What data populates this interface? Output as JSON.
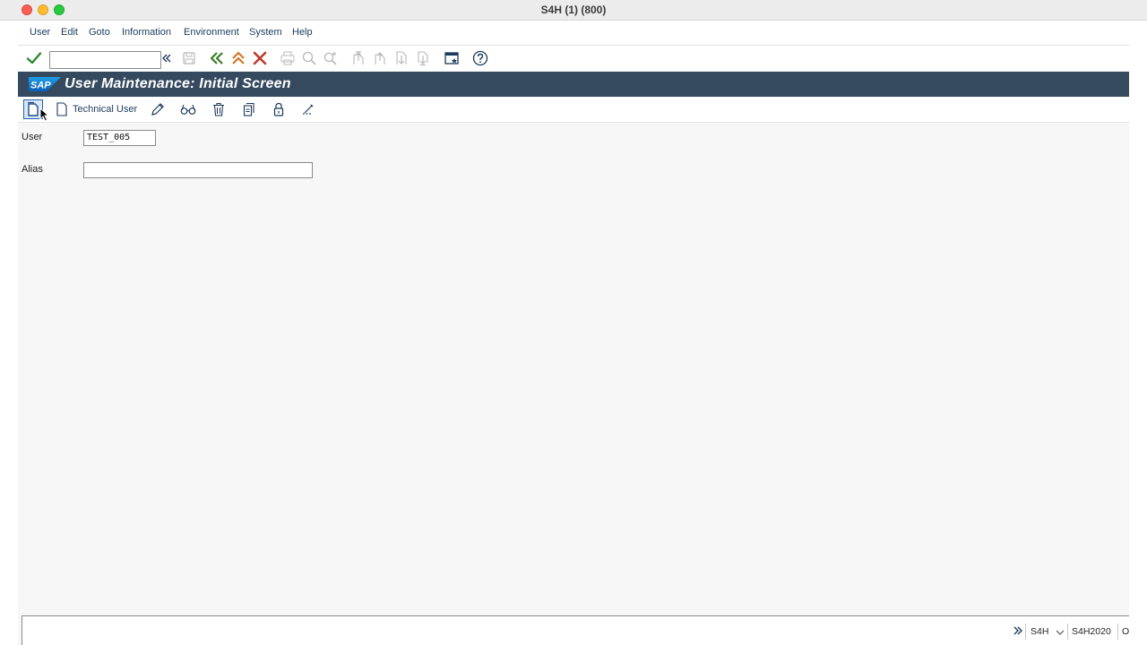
{
  "window": {
    "title": "S4H (1) (800)"
  },
  "menu": {
    "items": [
      {
        "label": "User"
      },
      {
        "label": "Edit"
      },
      {
        "label": "Goto"
      },
      {
        "label": "Information"
      },
      {
        "label": "Environment"
      },
      {
        "label": "System"
      },
      {
        "label": "Help"
      }
    ]
  },
  "command_field": {
    "value": "",
    "placeholder": ""
  },
  "header": {
    "logo_text": "SAP",
    "title": "User Maintenance: Initial Screen"
  },
  "app_toolbar": {
    "technical_user_label": "Technical User"
  },
  "form": {
    "user_label": "User",
    "user_value": "TEST_005",
    "alias_label": "Alias",
    "alias_value": ""
  },
  "status_bar": {
    "system": "S4H",
    "server": "S4H2020",
    "mode": "O"
  },
  "colors": {
    "header_bg": "#354a5f",
    "enter_green": "#2e8b2e",
    "back_green": "#3a7d2a",
    "exit_orange": "#d4772a",
    "cancel_red": "#c0392b",
    "link_blue": "#1b3a5c"
  }
}
